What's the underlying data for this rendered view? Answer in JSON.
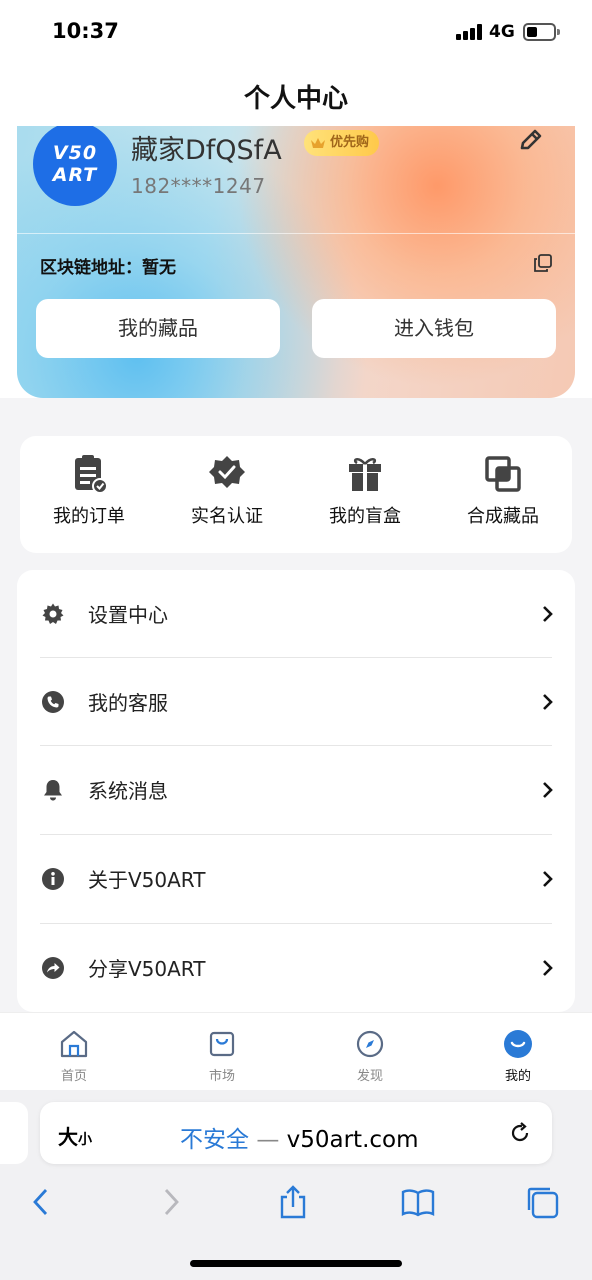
{
  "status_bar": {
    "time": "10:37",
    "network": "4G"
  },
  "header": {
    "title": "个人中心"
  },
  "profile": {
    "avatar_line1": "V50",
    "avatar_line2": "ART",
    "username": "藏家DfQSfA",
    "badge": "优先购",
    "phone": "182****1247",
    "chain_address": "区块链地址：暂无",
    "buttons": {
      "collection": "我的藏品",
      "wallet": "进入钱包"
    }
  },
  "quick_actions": [
    {
      "label": "我的订单",
      "icon": "order-list-icon"
    },
    {
      "label": "实名认证",
      "icon": "verified-badge-icon"
    },
    {
      "label": "我的盲盒",
      "icon": "gift-box-icon"
    },
    {
      "label": "合成藏品",
      "icon": "merge-icon"
    }
  ],
  "menu": [
    {
      "label": "设置中心",
      "icon": "gear-icon"
    },
    {
      "label": "我的客服",
      "icon": "phone-icon"
    },
    {
      "label": "系统消息",
      "icon": "bell-icon"
    },
    {
      "label": "关于V50ART",
      "icon": "info-icon"
    },
    {
      "label": "分享V50ART",
      "icon": "share-icon"
    }
  ],
  "tabs": [
    {
      "label": "首页",
      "icon": "home-icon"
    },
    {
      "label": "市场",
      "icon": "bag-icon"
    },
    {
      "label": "发现",
      "icon": "compass-icon"
    },
    {
      "label": "我的",
      "icon": "profile-icon",
      "active": true
    }
  ],
  "safari": {
    "text_size_big": "大",
    "text_size_small": "小",
    "insecure": "不安全",
    "dash": "—",
    "domain": "v50art.com"
  },
  "colors": {
    "brand_blue": "#1e6ee6",
    "link_blue": "#2a7ad6",
    "badge_gold": "#ffc94a"
  }
}
